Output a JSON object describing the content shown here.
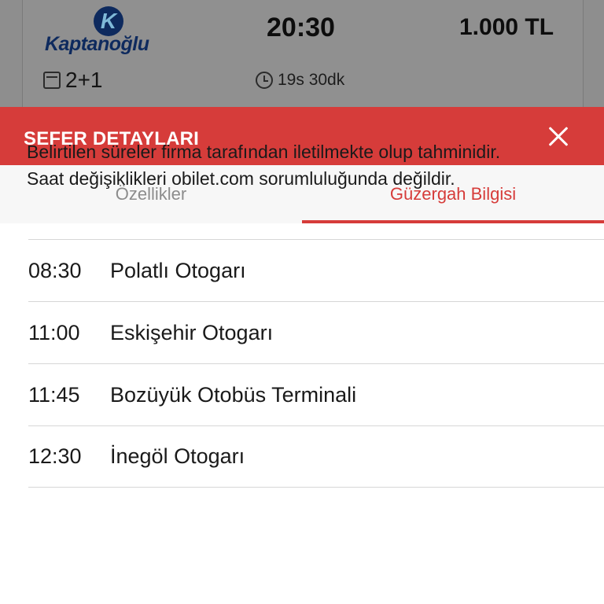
{
  "bus_card": {
    "company_logo_text": "Kaptanoğlu",
    "departure_time": "20:30",
    "price": "1.000 TL",
    "seat_layout": "2+1",
    "duration": "19s 30dk"
  },
  "sheet": {
    "title": "SEFER DETAYLARI",
    "tabs": [
      {
        "label": "Özellikler",
        "active": false
      },
      {
        "label": "Güzergah Bilgisi",
        "active": true
      }
    ],
    "disclaimer_line1": "Belirtilen süreler firma tarafından iletilmekte olup tahminidir.",
    "disclaimer_line2": "Saat değişiklikleri obilet.com sorumluluğunda değildir.",
    "stops": [
      {
        "time": "08:30",
        "name": "Polatlı Otogarı"
      },
      {
        "time": "11:00",
        "name": "Eskişehir Otogarı"
      },
      {
        "time": "11:45",
        "name": "Bozüyük Otobüs Terminali"
      },
      {
        "time": "12:30",
        "name": "İnegöl Otogarı"
      }
    ]
  },
  "colors": {
    "accent": "#d63c3a",
    "overlay": "#8e8e8e",
    "tab_bar": "#f7f7f7"
  },
  "icons": {
    "close": "close-icon",
    "seat": "seat-icon",
    "clock": "clock-icon"
  }
}
